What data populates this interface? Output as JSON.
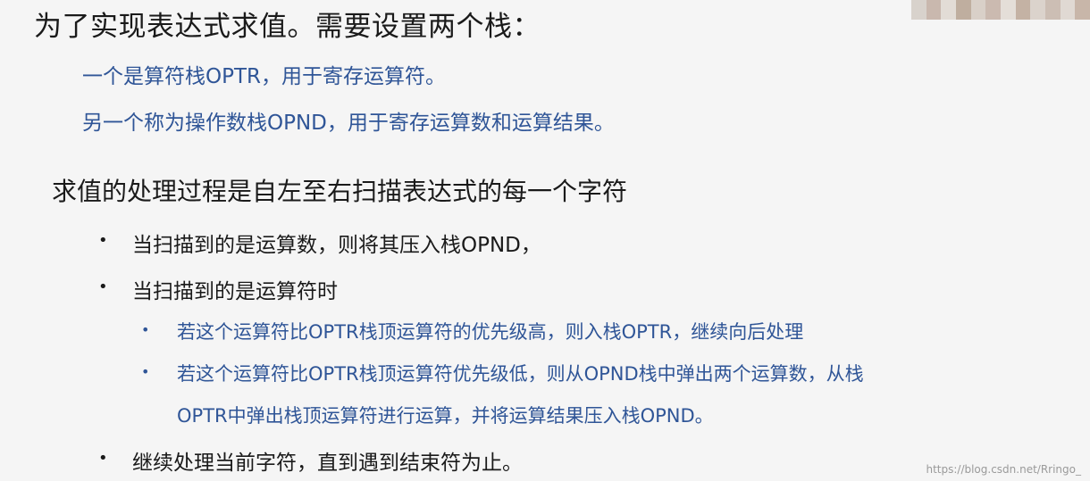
{
  "title": "为了实现表达式求值。需要设置两个栈：",
  "stacks": [
    "一个是算符栈OPTR，用于寄存运算符。",
    "另一个称为操作数栈OPND，用于寄存运算数和运算结果。"
  ],
  "process_heading": "求值的处理过程是自左至右扫描表达式的每一个字符",
  "bullet_char": "•",
  "steps": [
    "当扫描到的是运算数，则将其压入栈OPND，",
    "当扫描到的是运算符时",
    "继续处理当前字符，直到遇到结束符为止。"
  ],
  "operator_cases": [
    "若这个运算符比OPTR栈顶运算符的优先级高，则入栈OPTR，继续向后处理",
    "若这个运算符比OPTR栈顶运算符优先级低，则从OPND栈中弹出两个运算数，从栈",
    "OPTR中弹出栈顶运算符进行运算，并将运算结果压入栈OPND。"
  ],
  "watermark": "https://blog.csdn.net/Rringo_",
  "colors": {
    "text": "#1a1a1a",
    "accent": "#2f5597",
    "background": "#f5f5f5"
  }
}
